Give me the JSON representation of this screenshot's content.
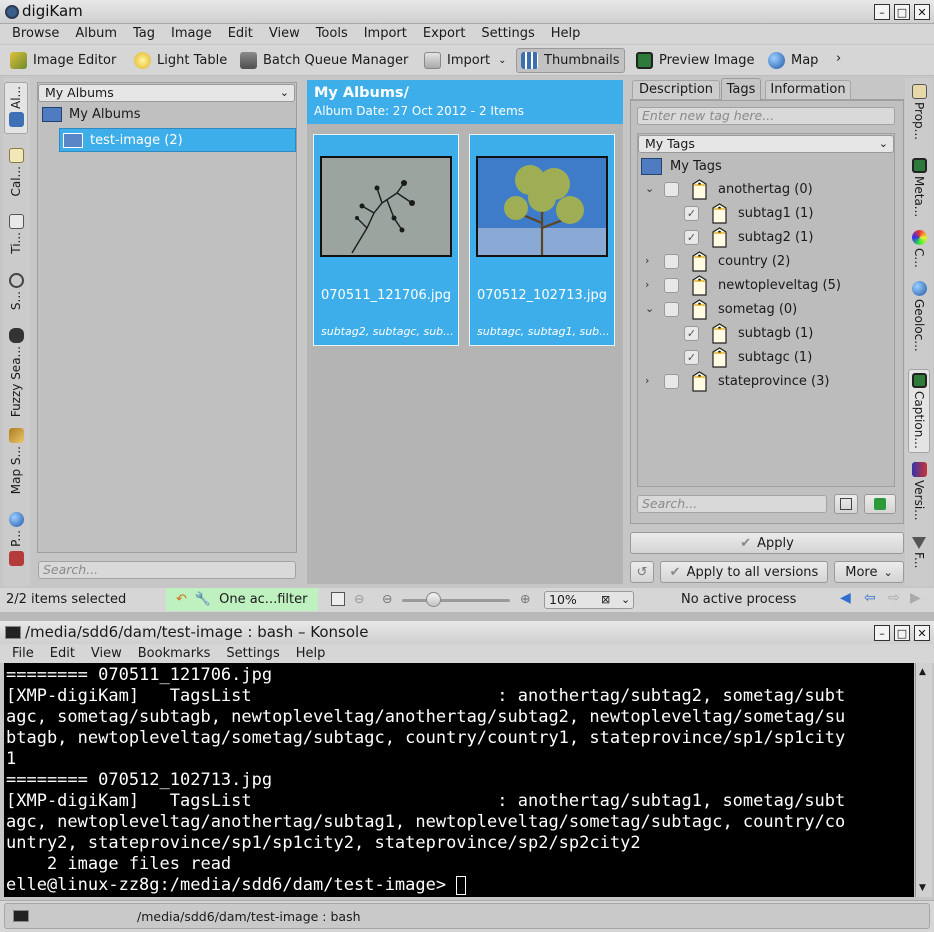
{
  "digikam": {
    "title": "digiKam",
    "menu": [
      "Browse",
      "Album",
      "Tag",
      "Image",
      "Edit",
      "View",
      "Tools",
      "Import",
      "Export",
      "Settings",
      "Help"
    ],
    "toolbar": {
      "image_editor": "Image Editor",
      "light_table": "Light Table",
      "batch_queue": "Batch Queue Manager",
      "import": "Import",
      "thumbnails": "Thumbnails",
      "preview_image": "Preview Image",
      "map": "Map"
    },
    "left_tabs": [
      "Al...",
      "Cal...",
      "Ti...",
      "S...",
      "Fuzzy Sea...",
      "Map S...",
      "P..."
    ],
    "albums": {
      "combo": "My Albums",
      "root": "My Albums",
      "child": "test-image (2)",
      "search_placeholder": "Search..."
    },
    "center": {
      "header_title": "My Albums/",
      "header_sub": "Album Date: 27 Oct 2012 - 2 Items",
      "thumbs": [
        {
          "file": "070511_121706.jpg",
          "tags": "subtag2, subtagc, sub..."
        },
        {
          "file": "070512_102713.jpg",
          "tags": "subtagc, subtag1, sub..."
        }
      ]
    },
    "right": {
      "tabs": [
        "Description",
        "Tags",
        "Information"
      ],
      "new_tag_placeholder": "Enter new tag here...",
      "tags_combo": "My Tags",
      "root": "My Tags",
      "tags": [
        {
          "label": "anothertag (0)",
          "expand": "⌄",
          "checked": false
        },
        {
          "label": "subtag1 (1)",
          "expand": "",
          "checked": true
        },
        {
          "label": "subtag2 (1)",
          "expand": "",
          "checked": true
        },
        {
          "label": "country (2)",
          "expand": "›",
          "checked": false
        },
        {
          "label": "newtopleveltag (5)",
          "expand": "›",
          "checked": false
        },
        {
          "label": "sometag (0)",
          "expand": "⌄",
          "checked": false
        },
        {
          "label": "subtagb (1)",
          "expand": "",
          "checked": true
        },
        {
          "label": "subtagc (1)",
          "expand": "",
          "checked": true
        },
        {
          "label": "stateprovince (3)",
          "expand": "›",
          "checked": false
        }
      ],
      "search_placeholder": "Search...",
      "apply": "Apply",
      "apply_all": "Apply to all versions",
      "more": "More"
    },
    "right_tabs": [
      "Prop...",
      "Meta...",
      "C...",
      "Geoloc...",
      "Caption...",
      "Versi...",
      "F..."
    ],
    "status": {
      "selected": "2/2 items selected",
      "filter": "One ac...filter",
      "zoom": "10%",
      "process": "No active process"
    }
  },
  "konsole": {
    "title": "/media/sdd6/dam/test-image : bash – Konsole",
    "menu": [
      "File",
      "Edit",
      "View",
      "Bookmarks",
      "Settings",
      "Help"
    ],
    "lines": [
      "======== 070511_121706.jpg",
      "[XMP-digiKam]   TagsList                        : anothertag/subtag2, sometag/subt",
      "agc, sometag/subtagb, newtopleveltag/anothertag/subtag2, newtopleveltag/sometag/su",
      "btagb, newtopleveltag/sometag/subtagc, country/country1, stateprovince/sp1/sp1city",
      "1",
      "======== 070512_102713.jpg",
      "[XMP-digiKam]   TagsList                        : anothertag/subtag1, sometag/subt",
      "agc, newtopleveltag/anothertag/subtag1, newtopleveltag/sometag/subtagc, country/co",
      "untry2, stateprovince/sp1/sp1city2, stateprovince/sp2/sp2city2",
      "    2 image files read",
      "elle@linux-zz8g:/media/sdd6/dam/test-image> "
    ],
    "tab_label": "/media/sdd6/dam/test-image : bash"
  }
}
